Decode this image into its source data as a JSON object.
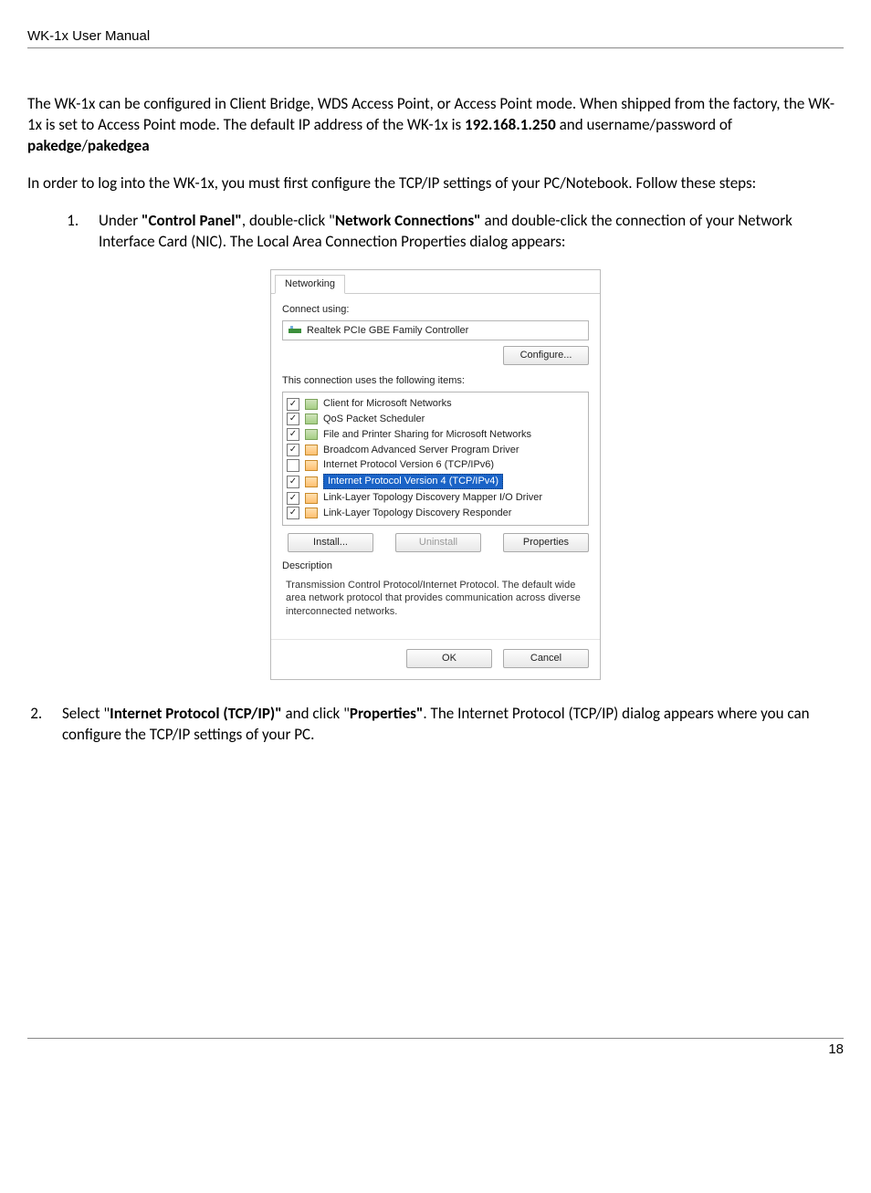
{
  "header": {
    "title": "WK-1x User Manual"
  },
  "para1": {
    "t1": "The WK-1x can be configured in Client Bridge, WDS Access Point, or Access Point mode.  When shipped from the factory, the WK-1x is set to Access Point mode.  The default IP address of the WK-1x is ",
    "b1": "192.168.1.250",
    "t2": " and username/password of ",
    "b2": "pakedge",
    "t3": "/",
    "b3": "pakedgea"
  },
  "para2": "In order to log into the WK-1x, you must first configure the TCP/IP settings of your PC/Notebook. Follow these steps:",
  "step1": {
    "t1": "Under ",
    "b1": "\"Control Panel\"",
    "t2": ", double-click \"",
    "b2": "Network Connections\"",
    "t3": " and double-click the connection of your Network Interface Card (NIC).  The Local Area Connection Properties dialog appears:"
  },
  "dialog": {
    "tab": "Networking",
    "connect_using": "Connect using:",
    "adapter": "Realtek PCIe GBE Family Controller",
    "configure": "Configure...",
    "uses_items": "This connection uses the following items:",
    "items": [
      {
        "checked": true,
        "iconClass": "net",
        "label": "Client for Microsoft Networks"
      },
      {
        "checked": true,
        "iconClass": "net",
        "label": "QoS Packet Scheduler"
      },
      {
        "checked": true,
        "iconClass": "net",
        "label": "File and Printer Sharing for Microsoft Networks"
      },
      {
        "checked": true,
        "iconClass": "orange",
        "label": "Broadcom Advanced Server Program Driver"
      },
      {
        "checked": false,
        "iconClass": "orange",
        "label": "Internet Protocol Version 6 (TCP/IPv6)"
      },
      {
        "checked": true,
        "iconClass": "orange",
        "label": "Internet Protocol Version 4 (TCP/IPv4)",
        "selected": true
      },
      {
        "checked": true,
        "iconClass": "orange",
        "label": "Link-Layer Topology Discovery Mapper I/O Driver"
      },
      {
        "checked": true,
        "iconClass": "orange",
        "label": "Link-Layer Topology Discovery Responder"
      }
    ],
    "install": "Install...",
    "uninstall": "Uninstall",
    "properties": "Properties",
    "description_label": "Description",
    "description_text": "Transmission Control Protocol/Internet Protocol. The default wide area network protocol that provides communication across diverse interconnected networks.",
    "ok": "OK",
    "cancel": "Cancel"
  },
  "step2": {
    "t1": "Select \"",
    "b1": "Internet Protocol (TCP/IP)\"",
    "t2": " and click \"",
    "b2": "Properties\"",
    "t3": ".  The Internet Protocol (TCP/IP) dialog appears where you can configure the TCP/IP settings of your PC."
  },
  "footer": {
    "page": "18"
  }
}
